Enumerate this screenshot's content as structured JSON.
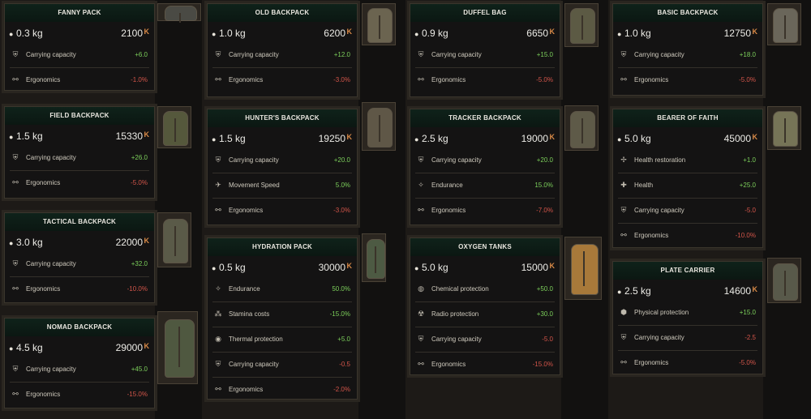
{
  "currency_symbol": "K",
  "cards": [
    {
      "name": "FANNY PACK",
      "weight": "0.3 kg",
      "price": "2100",
      "stats": [
        {
          "label": "Carrying capacity",
          "value": "+6.0",
          "tone": "pos",
          "icon": "shield-icon"
        },
        {
          "label": "Ergonomics",
          "value": "-1.0%",
          "tone": "neg",
          "icon": "runner-icon"
        }
      ]
    },
    {
      "name": "OLD BACKPACK",
      "weight": "1.0 kg",
      "price": "6200",
      "stats": [
        {
          "label": "Carrying capacity",
          "value": "+12.0",
          "tone": "pos",
          "icon": "shield-icon"
        },
        {
          "label": "Ergonomics",
          "value": "-3.0%",
          "tone": "neg",
          "icon": "runner-icon"
        }
      ]
    },
    {
      "name": "DUFFEL BAG",
      "weight": "0.9 kg",
      "price": "6650",
      "stats": [
        {
          "label": "Carrying capacity",
          "value": "+15.0",
          "tone": "pos",
          "icon": "shield-icon"
        },
        {
          "label": "Ergonomics",
          "value": "-5.0%",
          "tone": "neg",
          "icon": "runner-icon"
        }
      ]
    },
    {
      "name": "BASIC BACKPACK",
      "weight": "1.0 kg",
      "price": "12750",
      "stats": [
        {
          "label": "Carrying capacity",
          "value": "+18.0",
          "tone": "pos",
          "icon": "shield-icon"
        },
        {
          "label": "Ergonomics",
          "value": "-5.0%",
          "tone": "neg",
          "icon": "runner-icon"
        }
      ]
    },
    {
      "name": "FIELD BACKPACK",
      "weight": "1.5 kg",
      "price": "15330",
      "stats": [
        {
          "label": "Carrying capacity",
          "value": "+26.0",
          "tone": "pos",
          "icon": "shield-icon"
        },
        {
          "label": "Ergonomics",
          "value": "-5.0%",
          "tone": "neg",
          "icon": "runner-icon"
        }
      ]
    },
    {
      "name": "HUNTER'S BACKPACK",
      "weight": "1.5 kg",
      "price": "19250",
      "stats": [
        {
          "label": "Carrying capacity",
          "value": "+20.0",
          "tone": "pos",
          "icon": "shield-icon"
        },
        {
          "label": "Movement Speed",
          "value": "5.0%",
          "tone": "pos",
          "icon": "sprint-icon"
        },
        {
          "label": "Ergonomics",
          "value": "-3.0%",
          "tone": "neg",
          "icon": "runner-icon"
        }
      ]
    },
    {
      "name": "TRACKER BACKPACK",
      "weight": "2.5 kg",
      "price": "19000",
      "stats": [
        {
          "label": "Carrying capacity",
          "value": "+20.0",
          "tone": "pos",
          "icon": "shield-icon"
        },
        {
          "label": "Endurance",
          "value": "15.0%",
          "tone": "pos",
          "icon": "endurance-icon"
        },
        {
          "label": "Ergonomics",
          "value": "-7.0%",
          "tone": "neg",
          "icon": "runner-icon"
        }
      ]
    },
    {
      "name": "BEARER OF FAITH",
      "weight": "5.0 kg",
      "price": "45000",
      "stats": [
        {
          "label": "Health restoration",
          "value": "+1.0",
          "tone": "pos",
          "icon": "health-restore-icon"
        },
        {
          "label": "Health",
          "value": "+25.0",
          "tone": "pos",
          "icon": "health-icon"
        },
        {
          "label": "Carrying capacity",
          "value": "-5.0",
          "tone": "neg",
          "icon": "shield-icon"
        },
        {
          "label": "Ergonomics",
          "value": "-10.0%",
          "tone": "neg",
          "icon": "runner-icon"
        }
      ]
    },
    {
      "name": "TACTICAL BACKPACK",
      "weight": "3.0 kg",
      "price": "22000",
      "stats": [
        {
          "label": "Carrying capacity",
          "value": "+32.0",
          "tone": "pos",
          "icon": "shield-icon"
        },
        {
          "label": "Ergonomics",
          "value": "-10.0%",
          "tone": "neg",
          "icon": "runner-icon"
        }
      ]
    },
    {
      "name": "HYDRATION PACK",
      "weight": "0.5 kg",
      "price": "30000",
      "stats": [
        {
          "label": "Endurance",
          "value": "50.0%",
          "tone": "pos",
          "icon": "endurance-icon"
        },
        {
          "label": "Stamina costs",
          "value": "-15.0%",
          "tone": "pos",
          "icon": "stamina-icon"
        },
        {
          "label": "Thermal protection",
          "value": "+5.0",
          "tone": "pos",
          "icon": "thermal-icon"
        },
        {
          "label": "Carrying capacity",
          "value": "-0.5",
          "tone": "neg",
          "icon": "shield-icon"
        },
        {
          "label": "Ergonomics",
          "value": "-2.0%",
          "tone": "neg",
          "icon": "runner-icon"
        }
      ]
    },
    {
      "name": "OXYGEN TANKS",
      "weight": "5.0 kg",
      "price": "15000",
      "stats": [
        {
          "label": "Chemical protection",
          "value": "+50.0",
          "tone": "pos",
          "icon": "chemical-icon"
        },
        {
          "label": "Radio protection",
          "value": "+30.0",
          "tone": "pos",
          "icon": "radiation-icon"
        },
        {
          "label": "Carrying capacity",
          "value": "-5.0",
          "tone": "neg",
          "icon": "shield-icon"
        },
        {
          "label": "Ergonomics",
          "value": "-15.0%",
          "tone": "neg",
          "icon": "runner-icon"
        }
      ]
    },
    {
      "name": "PLATE CARRIER",
      "weight": "2.5 kg",
      "price": "14600",
      "stats": [
        {
          "label": "Physical protection",
          "value": "+15.0",
          "tone": "pos",
          "icon": "armor-icon"
        },
        {
          "label": "Carrying capacity",
          "value": "-2.5",
          "tone": "neg",
          "icon": "shield-icon"
        },
        {
          "label": "Ergonomics",
          "value": "-5.0%",
          "tone": "neg",
          "icon": "runner-icon"
        }
      ]
    },
    {
      "name": "NOMAD BACKPACK",
      "weight": "4.5 kg",
      "price": "29000",
      "stats": [
        {
          "label": "Carrying capacity",
          "value": "+45.0",
          "tone": "pos",
          "icon": "shield-icon"
        },
        {
          "label": "Ergonomics",
          "value": "-15.0%",
          "tone": "neg",
          "icon": "runner-icon"
        }
      ]
    }
  ],
  "item_colors": {
    "FANNY PACK": "#4a4a44",
    "OLD BACKPACK": "#6b6450",
    "DUFFEL BAG": "#5c5a44",
    "BASIC BACKPACK": "#6a665a",
    "FIELD BACKPACK": "#55583c",
    "HUNTER'S BACKPACK": "#5f5747",
    "TRACKER BACKPACK": "#5e5a48",
    "BEARER OF FAITH": "#767457",
    "TACTICAL BACKPACK": "#5a5a48",
    "HYDRATION PACK": "#4d5a43",
    "OXYGEN TANKS": "#a8793a",
    "PLATE CARRIER": "#58594a",
    "NOMAD BACKPACK": "#4f5840"
  }
}
